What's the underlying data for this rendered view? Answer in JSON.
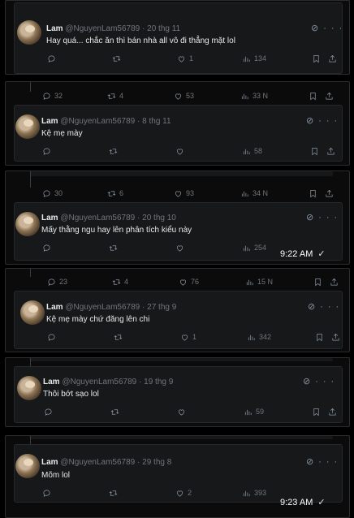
{
  "tweets": [
    {
      "name": "Lam",
      "handle": "@NguyenLam56789",
      "date": "20 thg 11",
      "text": "Hay quá... chắc ăn thì bán nhà all vô đi thẳng mặt lol",
      "replies": "",
      "retweets": "",
      "likes": "1",
      "views": "134"
    },
    {
      "name": "Lam",
      "handle": "@NguyenLam56789",
      "date": "8 thg 11",
      "text": "Kệ mẹ mày",
      "replies": "",
      "retweets": "",
      "likes": "",
      "views": "58"
    },
    {
      "name": "Lam",
      "handle": "@NguyenLam56789",
      "date": "20 thg 10",
      "text": "Mấy thằng ngu hay lên phân tích kiểu này",
      "replies": "",
      "retweets": "",
      "likes": "",
      "views": "254"
    },
    {
      "name": "Lam",
      "handle": "@NguyenLam56789",
      "date": "27 thg 9",
      "text": "Kệ mẹ mày chứ đăng lên chi",
      "replies": "",
      "retweets": "",
      "likes": "1",
      "views": "342"
    },
    {
      "name": "Lam",
      "handle": "@NguyenLam56789",
      "date": "19 thg 9",
      "text": "Thôi bớt sạo lol",
      "replies": "",
      "retweets": "",
      "likes": "",
      "views": "59"
    },
    {
      "name": "Lam",
      "handle": "@NguyenLam56789",
      "date": "29 thg 8",
      "text": "Mõm lol",
      "replies": "",
      "retweets": "",
      "likes": "2",
      "views": "393"
    }
  ],
  "parent_stats": [
    {
      "replies": "32",
      "retweets": "4",
      "likes": "53",
      "views": "33 N"
    },
    {
      "replies": "30",
      "retweets": "6",
      "likes": "93",
      "views": "34 N"
    },
    {
      "replies": "23",
      "retweets": "4",
      "likes": "76",
      "views": "15 N"
    }
  ],
  "messages": [
    {
      "time": "9:22 AM"
    },
    {
      "time": "9:23 AM"
    }
  ],
  "icons": {
    "grok": "grok-icon",
    "more": "more-icon",
    "reply": "reply-icon",
    "retweet": "retweet-icon",
    "like": "like-icon",
    "views": "views-icon",
    "bookmark": "bookmark-icon",
    "share": "share-icon",
    "read": "check-icon"
  }
}
